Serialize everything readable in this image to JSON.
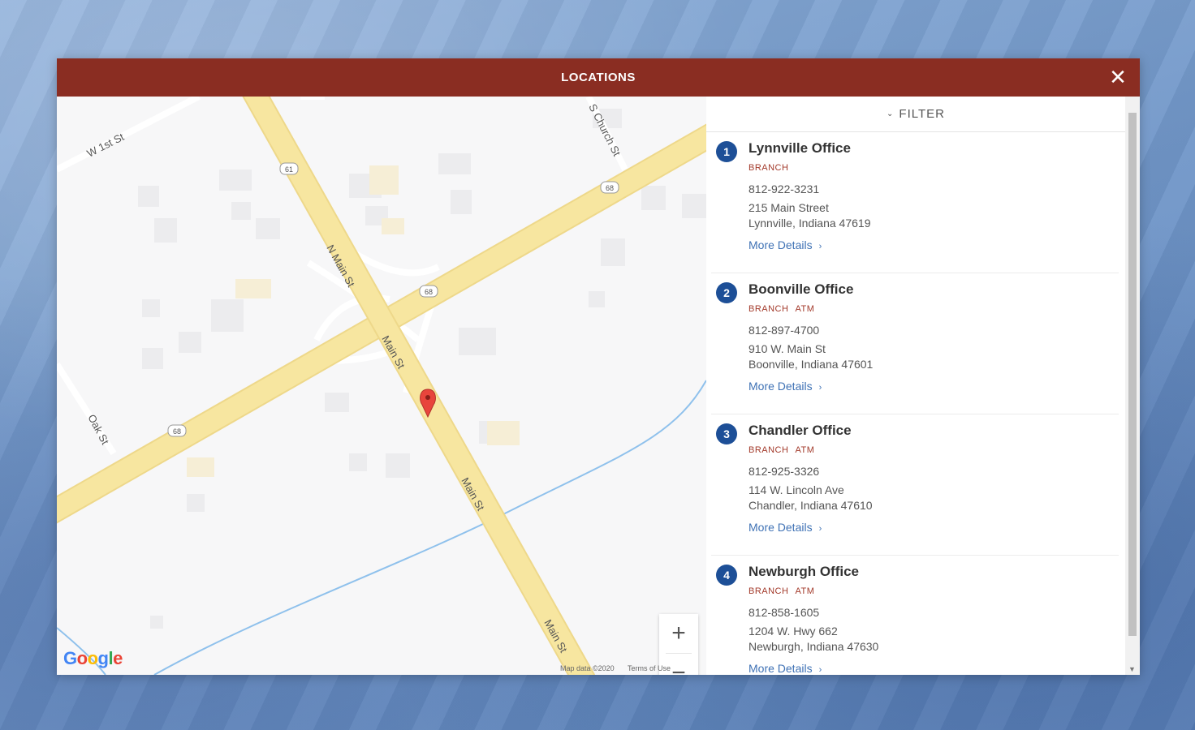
{
  "modal": {
    "title": "LOCATIONS",
    "close_icon": "close-icon"
  },
  "map": {
    "streets": {
      "w_1st": "W 1st St",
      "s_church": "S Church St",
      "n_main": "N Main St",
      "main_1": "Main St",
      "main_2": "Main St",
      "main_3": "Main St",
      "oak": "Oak St"
    },
    "route_shields": [
      "61",
      "68",
      "68",
      "68"
    ],
    "marker_icon": "map-pin-icon",
    "zoom_in": "+",
    "zoom_out": "−",
    "logo": "Google",
    "footer_data": "Map data ©2020",
    "footer_terms": "Terms of Use",
    "colors": {
      "road": "#f7e6a0",
      "road_edge": "#eed88a",
      "water": "#8fc1ec",
      "marker": "#e8453c"
    }
  },
  "panel": {
    "filter_label": "FILTER",
    "locations": [
      {
        "number": "1",
        "name": "Lynnville Office",
        "tags": [
          "BRANCH"
        ],
        "phone": "812-922-3231",
        "address1": "215 Main Street",
        "address2": "Lynnville, Indiana 47619",
        "more": "More Details"
      },
      {
        "number": "2",
        "name": "Boonville Office",
        "tags": [
          "BRANCH",
          "ATM"
        ],
        "phone": "812-897-4700",
        "address1": "910 W. Main St",
        "address2": "Boonville, Indiana 47601",
        "more": "More Details"
      },
      {
        "number": "3",
        "name": "Chandler Office",
        "tags": [
          "BRANCH",
          "ATM"
        ],
        "phone": "812-925-3326",
        "address1": "114 W. Lincoln Ave",
        "address2": "Chandler, Indiana 47610",
        "more": "More Details"
      },
      {
        "number": "4",
        "name": "Newburgh Office",
        "tags": [
          "BRANCH",
          "ATM"
        ],
        "phone": "812-858-1605",
        "address1": "1204 W. Hwy 662",
        "address2": "Newburgh, Indiana 47630",
        "more": "More Details"
      }
    ]
  },
  "theme": {
    "header_color": "#8a2d22",
    "number_badge": "#1d4f97",
    "tag_color": "#a33a2b",
    "link_color": "#3f72b5"
  }
}
